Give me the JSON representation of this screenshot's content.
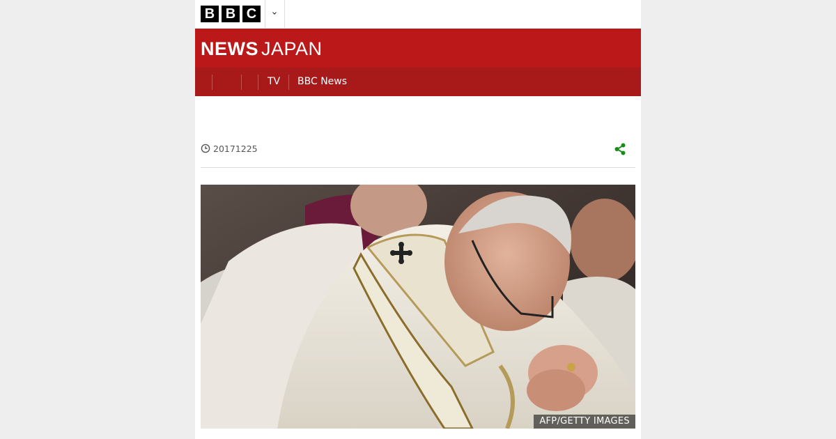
{
  "header": {
    "logo_letters": [
      "B",
      "B",
      "C"
    ]
  },
  "masthead": {
    "title_bold": "NEWS",
    "title_light": "JAPAN"
  },
  "nav": {
    "items": [
      "TV",
      "BBC News"
    ]
  },
  "article": {
    "date": "20171225",
    "image_credit": "AFP/GETTY IMAGES"
  },
  "colors": {
    "brand_red": "#bb1919",
    "nav_red": "#a81a1a",
    "share_green": "#1a8a1a"
  },
  "icons": {
    "clock": "clock-icon",
    "share": "share-icon",
    "menu": "chevron-down-icon"
  }
}
